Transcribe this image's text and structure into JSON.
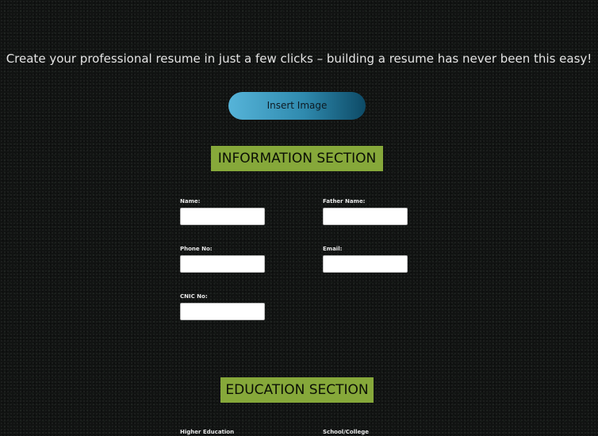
{
  "tagline": "Create your professional resume in just a few clicks – building a resume has never been this easy!",
  "insert_image_button": {
    "label": "Insert Image"
  },
  "information_section": {
    "heading": "INFORMATION SECTION",
    "fields": {
      "name": {
        "label": "Name:",
        "value": ""
      },
      "father_name": {
        "label": "Father Name:",
        "value": ""
      },
      "phone": {
        "label": "Phone No:",
        "value": ""
      },
      "email": {
        "label": "Email:",
        "value": ""
      },
      "cnic": {
        "label": "CNIC No:",
        "value": ""
      }
    }
  },
  "education_section": {
    "heading": "EDUCATION SECTION",
    "fields": {
      "higher_education": {
        "label": "Higher Education"
      },
      "school_college": {
        "label": "School/College"
      }
    }
  },
  "colors": {
    "background": "#111312",
    "section_heading_bg": "#86a83a",
    "button_gradient_start": "#56b4d9",
    "button_gradient_end": "#0d4a66"
  }
}
